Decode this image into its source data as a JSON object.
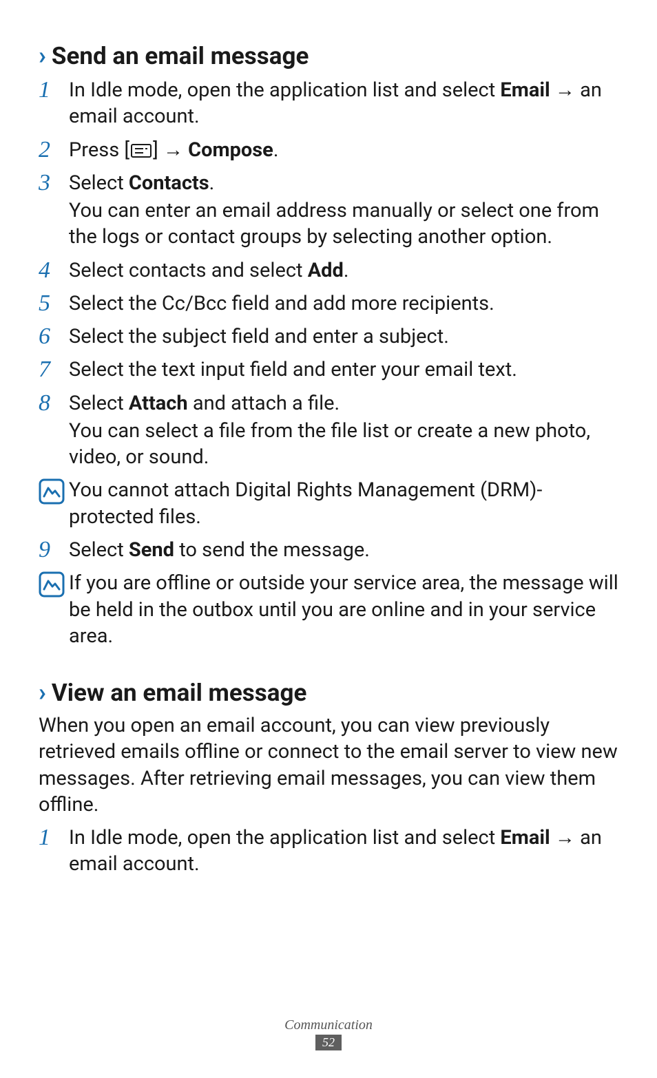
{
  "section1": {
    "title": "Send an email message"
  },
  "steps1": {
    "s1a": "In Idle mode, open the application list and select ",
    "s1b": "Email",
    "s1c": " → an email account.",
    "s2a": "Press [",
    "s2b": "] → ",
    "s2c": "Compose",
    "s2d": ".",
    "s3a": "Select ",
    "s3b": "Contacts",
    "s3c": ".",
    "s3d": "You can enter an email address manually or select one from the logs or contact groups by selecting another option.",
    "s4a": "Select contacts and select ",
    "s4b": "Add",
    "s4c": ".",
    "s5": "Select the Cc/Bcc field and add more recipients.",
    "s6": "Select the subject field and enter a subject.",
    "s7": "Select the text input field and enter your email text.",
    "s8a": "Select ",
    "s8b": "Attach",
    "s8c": " and attach a file.",
    "s8d": "You can select a file from the file list or create a new photo, video, or sound.",
    "s9a": "Select ",
    "s9b": "Send",
    "s9c": " to send the message."
  },
  "note1": "You cannot attach Digital Rights Management (DRM)-protected files.",
  "note2": "If you are offline or outside your service area, the message will be held in the outbox until you are online and in your service area.",
  "section2": {
    "title": "View an email message"
  },
  "para2": "When you open an email account, you can view previously retrieved emails offline or connect to the email server to view new messages. After retrieving email messages, you can view them offline.",
  "steps2": {
    "s1a": "In Idle mode, open the application list and select ",
    "s1b": "Email",
    "s1c": " → an email account."
  },
  "nums": {
    "n1": "1",
    "n2": "2",
    "n3": "3",
    "n4": "4",
    "n5": "5",
    "n6": "6",
    "n7": "7",
    "n8": "8",
    "n9": "9"
  },
  "footer": {
    "label": "Communication",
    "page": "52"
  }
}
